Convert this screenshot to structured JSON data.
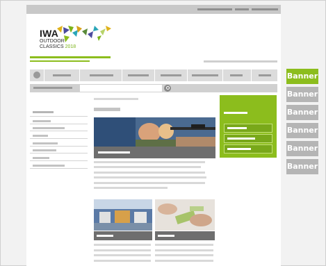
{
  "logo": {
    "title": "IWA",
    "line1": "OUTDOOR",
    "line2": "CLASSICS",
    "year": "2018"
  },
  "banners": [
    "Banner",
    "Banner",
    "Banner",
    "Banner",
    "Banner",
    "Banner"
  ],
  "colors": {
    "accent": "#8cbd1d",
    "banner_active": "#8cbd1d",
    "banner_inactive": "#b5b5b5",
    "caption": "#6e6e6e"
  },
  "icons": {
    "home": "home-icon",
    "search": "search-icon"
  }
}
